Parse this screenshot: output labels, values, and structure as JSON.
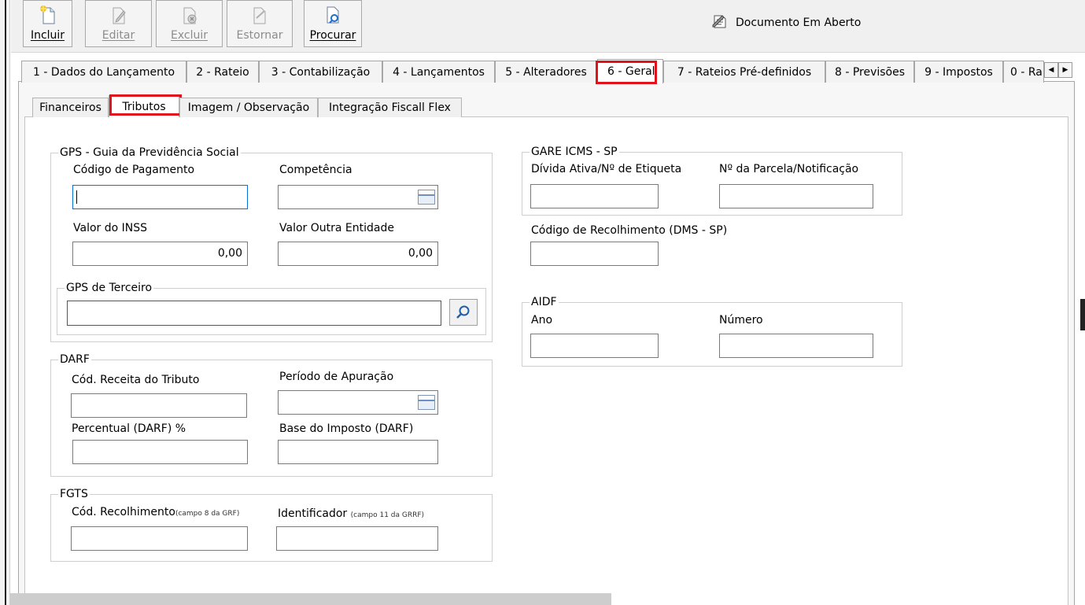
{
  "toolbar": {
    "incluir": "Incluir",
    "editar": "Editar",
    "excluir": "Excluir",
    "estornar": "Estornar",
    "procurar": "Procurar"
  },
  "document_status": "Documento Em Aberto",
  "tabs": [
    {
      "label": "1 - Dados do Lançamento"
    },
    {
      "label": "2 - Rateio"
    },
    {
      "label": "3 - Contabilização"
    },
    {
      "label": "4 - Lançamentos"
    },
    {
      "label": "5 - Alteradores"
    },
    {
      "label": "6 - Geral",
      "active": true
    },
    {
      "label": "7 - Rateios Pré-definidos"
    },
    {
      "label": "8 - Previsões"
    },
    {
      "label": "9 - Impostos"
    },
    {
      "label": "0 - Ra"
    }
  ],
  "subtabs": [
    {
      "label": "Financeiros"
    },
    {
      "label": "Tributos",
      "active": true
    },
    {
      "label": "Imagem / Observação"
    },
    {
      "label": "Integração Fiscall Flex"
    }
  ],
  "gps": {
    "title": "GPS - Guia da Previdência Social",
    "codigo_pagamento": "Código de Pagamento",
    "competencia": "Competência",
    "valor_inss": "Valor do INSS",
    "valor_inss_value": "0,00",
    "valor_outra": "Valor Outra Entidade",
    "valor_outra_value": "0,00",
    "terceiro": "GPS de Terceiro"
  },
  "darf": {
    "title": "DARF",
    "cod_receita": "Cód. Receita do Tributo",
    "periodo": "Período de Apuração",
    "percentual": "Percentual (DARF) %",
    "base": "Base do Imposto (DARF)"
  },
  "fgts": {
    "title": "FGTS",
    "cod_recolhimento": "Cód. Recolhimento",
    "cod_note": "(campo 8 da GRF)",
    "identificador": "Identificador",
    "ident_note": "(campo 11 da GRRF)"
  },
  "gare": {
    "title": "GARE ICMS - SP",
    "divida": "Dívida Ativa/Nº de Etiqueta",
    "parcela": "Nº da Parcela/Notificação",
    "cod_dms": "Código de Recolhimento (DMS - SP)"
  },
  "aidf": {
    "title": "AIDF",
    "ano": "Ano",
    "numero": "Número"
  },
  "colors": {
    "highlight": "#e0121b",
    "focus_border": "#0a6ed8"
  }
}
